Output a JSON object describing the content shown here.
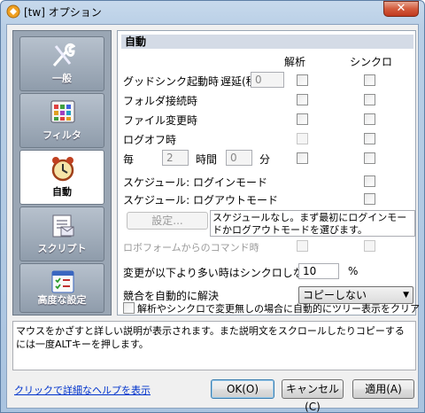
{
  "window": {
    "title": "[tw] オプション",
    "close_label": "✕"
  },
  "sidebar": {
    "items": [
      {
        "label": "一般",
        "icon": "wrench-icon"
      },
      {
        "label": "フィルタ",
        "icon": "grid-icon"
      },
      {
        "label": "自動",
        "icon": "alarm-clock-icon",
        "active": true
      },
      {
        "label": "スクリプト",
        "icon": "script-icon"
      },
      {
        "label": "高度な設定",
        "icon": "checklist-icon"
      }
    ]
  },
  "panel": {
    "section_title": "自動",
    "col_analyze": "解析",
    "col_sync": "シンクロ",
    "rows": {
      "goodsync_start": "グッドシンク起動時",
      "delay_label": "遅延(秒)",
      "delay_value": "0",
      "folder_connect": "フォルダ接続時",
      "file_change": "ファイル変更時",
      "logoff": "ログオフ時",
      "every_label": "毎",
      "every_value": "2",
      "hours_label": "時間",
      "minutes_value": "0",
      "minutes_label": "分",
      "schedule_login": "スケジュール: ログインモード",
      "schedule_logout": "スケジュール: ログアウトモード",
      "settings_button": "設定...",
      "schedule_note": "スケジュールなし。まず最初にログインモードかログアウトモードを選びます。",
      "roboform_command": "ロボフォームからのコマンド時",
      "no_sync_threshold": "変更が以下より多い時はシンクロしない:",
      "threshold_value": "10",
      "threshold_unit": "%",
      "auto_resolve": "競合を自動的に解決",
      "resolve_option": "コピーしない",
      "clear_tree": "解析やシンクロで変更無しの場合に自動的にツリー表示をクリア"
    }
  },
  "description": "マウスをかざすと詳しい説明が表示されます。また説明文をスクロールしたりコピーするには一度ALTキーを押します。",
  "footer": {
    "help_link": "クリックで詳細なヘルプを表示",
    "ok": "OK(O)",
    "cancel": "キャンセル(C)",
    "apply": "適用(A)"
  }
}
